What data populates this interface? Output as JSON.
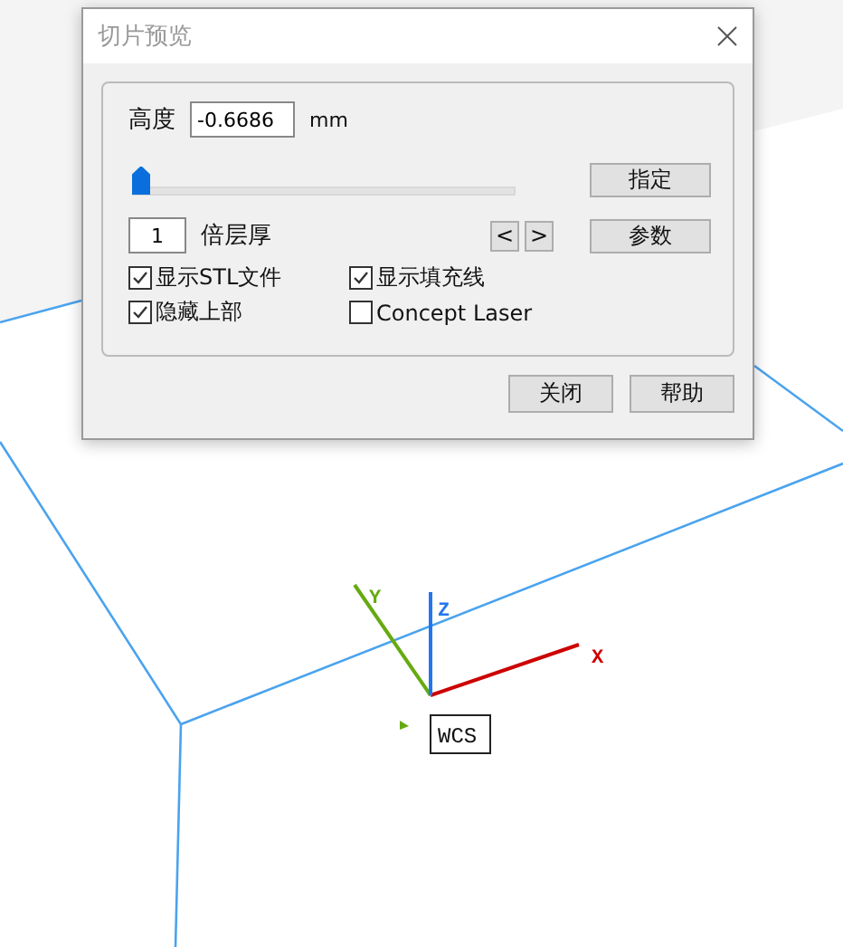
{
  "viewport": {
    "axes": [
      {
        "kind": "x",
        "label": "X",
        "color": "#cc0000"
      },
      {
        "kind": "y",
        "label": "Y",
        "color": "#66aa11"
      },
      {
        "kind": "z",
        "label": "Z",
        "color": "#2277ee"
      }
    ],
    "origin_label": "WCS"
  },
  "dialog": {
    "title": "切片预览",
    "height": {
      "label": "高度",
      "value": "-0.6686",
      "unit": "mm"
    },
    "slider": {
      "level": 0.0
    },
    "layers": {
      "value": "1",
      "label": "倍层厚"
    },
    "step_buttons": [
      "<",
      ">"
    ],
    "side_buttons": [
      "指定",
      "参数"
    ],
    "checkboxes": [
      {
        "label": "显示STL文件",
        "checked": true
      },
      {
        "label": "显示填充线",
        "checked": true
      },
      {
        "label": "隐藏上部",
        "checked": true
      },
      {
        "label": "Concept Laser",
        "checked": false
      }
    ],
    "buttons": [
      "关闭",
      "帮助"
    ]
  }
}
